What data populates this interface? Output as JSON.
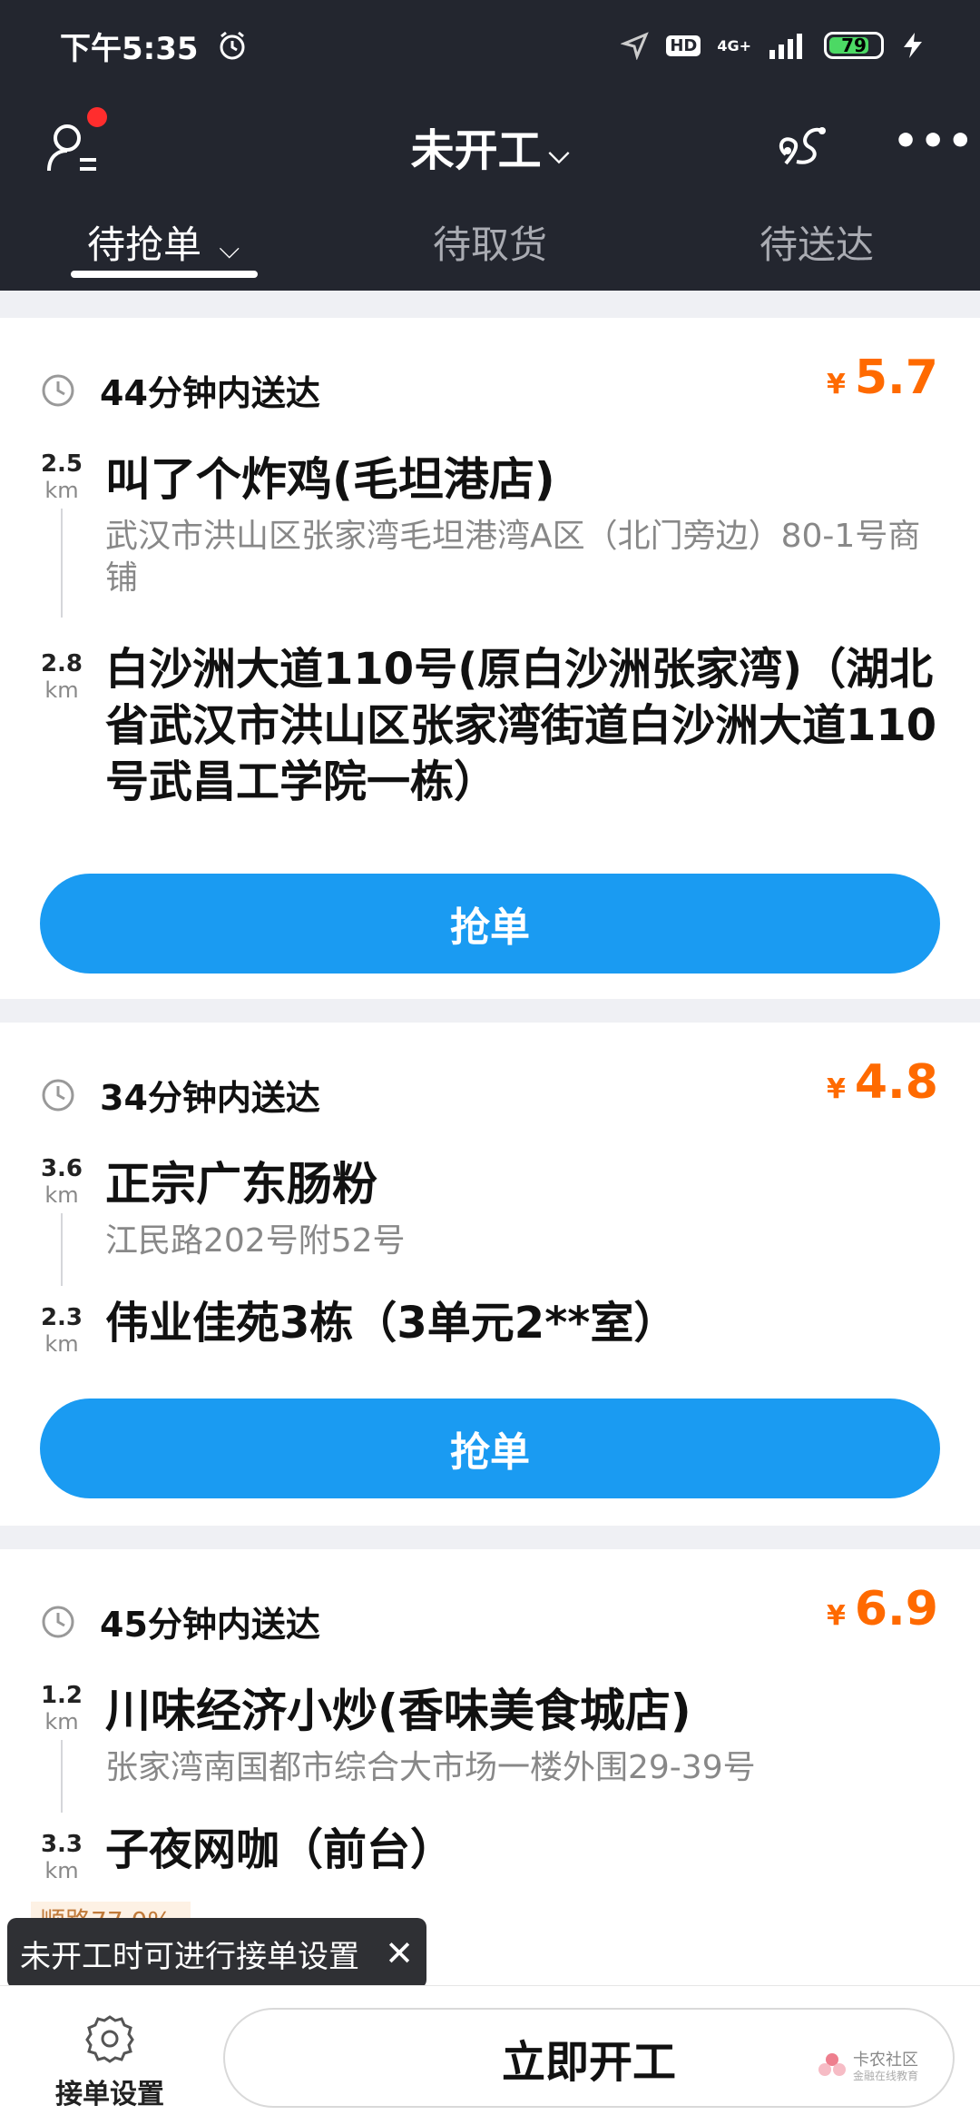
{
  "status_bar": {
    "time": "下午5:35",
    "network": "4G+",
    "hd": "HD",
    "battery": "79",
    "battery_level": 0.79
  },
  "header": {
    "title": "未开工",
    "tabs": [
      {
        "label": "待抢单",
        "active": true
      },
      {
        "label": "待取货",
        "active": false
      },
      {
        "label": "待送达",
        "active": false
      }
    ]
  },
  "orders": [
    {
      "deadline": "44分钟内送达",
      "currency": "¥",
      "price": "5.7",
      "pickup_distance": "2.5",
      "pickup_unit": "km",
      "shop": "叫了个炸鸡(毛坦港店)",
      "shop_address": "武汉市洪山区张家湾毛坦港湾A区（北门旁边）80-1号商铺",
      "dropoff_distance": "2.8",
      "dropoff_unit": "km",
      "destination": "白沙洲大道110号(原白沙洲张家湾)（湖北省武汉市洪山区张家湾街道白沙洲大道110号武昌工学院一栋）",
      "action": "抢单"
    },
    {
      "deadline": "34分钟内送达",
      "currency": "¥",
      "price": "4.8",
      "pickup_distance": "3.6",
      "pickup_unit": "km",
      "shop": "正宗广东肠粉",
      "shop_address": "江民路202号附52号",
      "dropoff_distance": "2.3",
      "dropoff_unit": "km",
      "destination": "伟业佳苑3栋（3单元2**室）",
      "action": "抢单"
    },
    {
      "deadline": "45分钟内送达",
      "currency": "¥",
      "price": "6.9",
      "pickup_distance": "1.2",
      "pickup_unit": "km",
      "shop": "川味经济小炒(香味美食城店)",
      "shop_address": "张家湾南国都市综合大市场一楼外围29-39号",
      "dropoff_distance": "3.3",
      "dropoff_unit": "km",
      "destination": "子夜网咖（前台）",
      "tag": "顺路77.0%"
    }
  ],
  "toast": {
    "text": "未开工时可进行接单设置",
    "close": "✕"
  },
  "bottom": {
    "settings_label": "接单设置",
    "start_label": "立即开工"
  },
  "watermark": {
    "brand": "卡农社区",
    "sub": "金融在线教育"
  },
  "colors": {
    "header_bg": "#23262f",
    "price": "#ff6a00",
    "button": "#1a9bf2"
  }
}
